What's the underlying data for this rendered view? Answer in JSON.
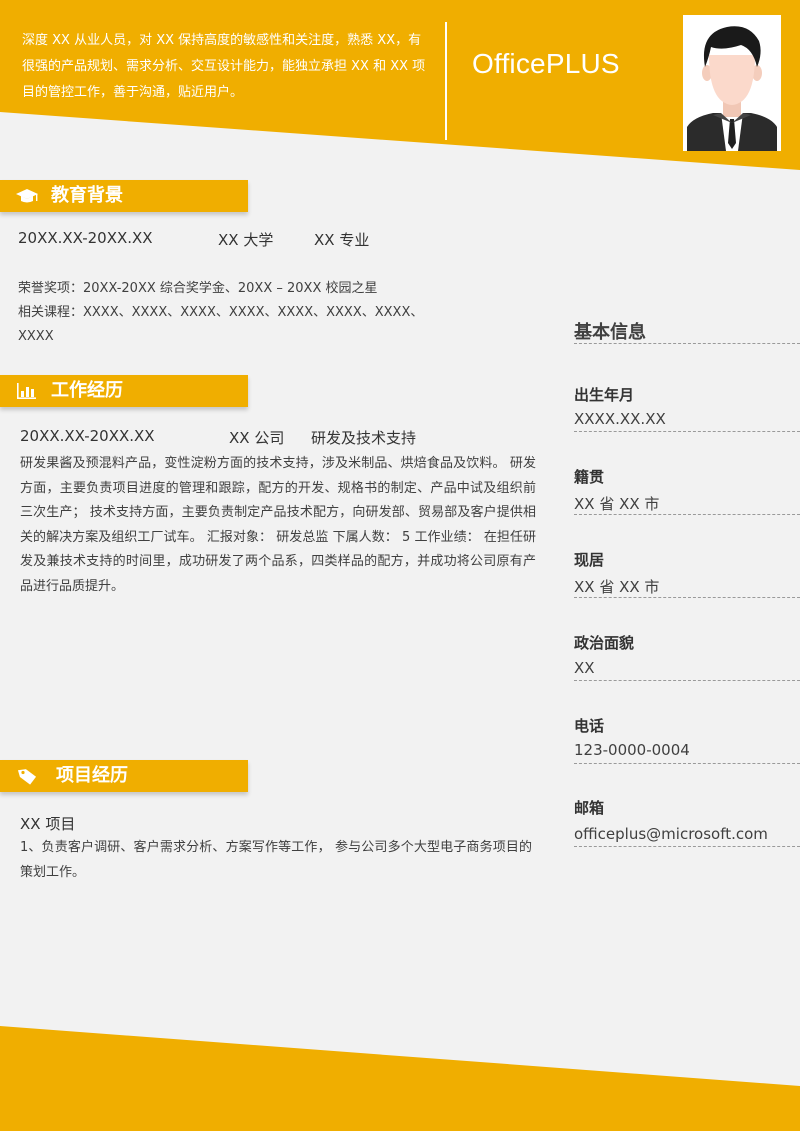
{
  "colors": {
    "accent": "#f0ae00",
    "background": "#f2f2f2",
    "text": "#404040"
  },
  "header": {
    "intro": "深度 XX 从业人员，对 XX 保持高度的敏感性和关注度，熟悉 XX，有很强的产品规划、需求分析、交互设计能力，能独立承担 XX 和 XX 项目的管控工作，善于沟通，贴近用户。",
    "brand": "OfficePLUS"
  },
  "education": {
    "title": "教育背景",
    "icon": "graduation-cap-icon",
    "date": "20XX.XX-20XX.XX",
    "school": "XX 大学",
    "major": "XX 专业",
    "honors": "荣誉奖项：20XX-20XX  综合奖学金、20XX  –  20XX 校园之星",
    "courses_line1": "相关课程：XXXX、XXXX、XXXX、XXXX、XXXX、XXXX、XXXX、",
    "courses_line2": "XXXX"
  },
  "work": {
    "title": "工作经历",
    "icon": "bar-chart-icon",
    "date": "20XX.XX-20XX.XX",
    "company": "XX 公司",
    "position": "研发及技术支持",
    "description": "研发果酱及预混料产品，变性淀粉方面的技术支持，涉及米制品、烘焙食品及饮料。 研发方面，主要负责项目进度的管理和跟踪，配方的开发、规格书的制定、产品中试及组织前三次生产； 技术支持方面，主要负责制定产品技术配方，向研发部、贸易部及客户提供相关的解决方案及组织工厂试车。 汇报对象： 研发总监 下属人数： 5 工作业绩： 在担任研发及兼技术支持的时间里，成功研发了两个品系，四类样品的配方，并成功将公司原有产品进行品质提升。"
  },
  "projects": {
    "title": "项目经历",
    "icon": "tag-icon",
    "name": "XX 项目",
    "description": "1、负责客户调研、客户需求分析、方案写作等工作， 参与公司多个大型电子商务项目的策划工作。"
  },
  "basic_info": {
    "title": "基本信息",
    "items": [
      {
        "label": "出生年月",
        "value": "XXXX.XX.XX"
      },
      {
        "label": "籍贯",
        "value": "XX 省 XX 市"
      },
      {
        "label": "现居",
        "value": "XX 省 XX 市"
      },
      {
        "label": "政治面貌",
        "value": "XX"
      },
      {
        "label": "电话",
        "value": "123-0000-0004"
      },
      {
        "label": "邮箱",
        "value": "officeplus@microsoft.com"
      }
    ]
  }
}
